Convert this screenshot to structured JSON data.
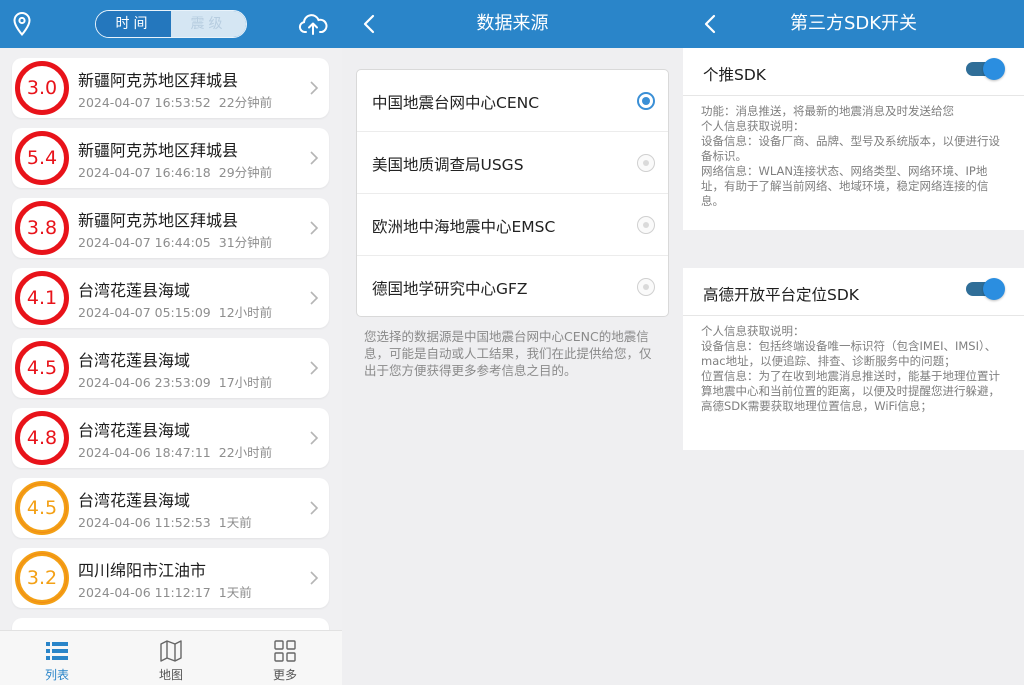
{
  "screen1": {
    "segment": {
      "time": "时间",
      "magnitude": "震级"
    },
    "events": [
      {
        "mag": "3.0",
        "place": "新疆阿克苏地区拜城县",
        "time": "2024-04-07 16:53:52",
        "ago": "22分钟前",
        "level": "red"
      },
      {
        "mag": "5.4",
        "place": "新疆阿克苏地区拜城县",
        "time": "2024-04-07 16:46:18",
        "ago": "29分钟前",
        "level": "red"
      },
      {
        "mag": "3.8",
        "place": "新疆阿克苏地区拜城县",
        "time": "2024-04-07 16:44:05",
        "ago": "31分钟前",
        "level": "red"
      },
      {
        "mag": "4.1",
        "place": "台湾花莲县海域",
        "time": "2024-04-07 05:15:09",
        "ago": "12小时前",
        "level": "red"
      },
      {
        "mag": "4.5",
        "place": "台湾花莲县海域",
        "time": "2024-04-06 23:53:09",
        "ago": "17小时前",
        "level": "red"
      },
      {
        "mag": "4.8",
        "place": "台湾花莲县海域",
        "time": "2024-04-06 18:47:11",
        "ago": "22小时前",
        "level": "red"
      },
      {
        "mag": "4.5",
        "place": "台湾花莲县海域",
        "time": "2024-04-06 11:52:53",
        "ago": "1天前",
        "level": "orange"
      },
      {
        "mag": "3.2",
        "place": "四川绵阳市江油市",
        "time": "2024-04-06 11:12:17",
        "ago": "1天前",
        "level": "orange"
      }
    ],
    "tabs": [
      {
        "label": "列表",
        "icon": "list-icon",
        "active": true
      },
      {
        "label": "地图",
        "icon": "map-icon",
        "active": false
      },
      {
        "label": "更多",
        "icon": "grid-icon",
        "active": false
      }
    ]
  },
  "screen2": {
    "title": "数据来源",
    "sources": [
      {
        "label": "中国地震台网中心CENC",
        "selected": true
      },
      {
        "label": "美国地质调查局USGS",
        "selected": false
      },
      {
        "label": "欧洲地中海地震中心EMSC",
        "selected": false
      },
      {
        "label": "德国地学研究中心GFZ",
        "selected": false
      }
    ],
    "note": "您选择的数据源是中国地震台网中心CENC的地震信息，可能是自动或人工结果，我们在此提供给您，仅出于您方便获得更多参考信息之目的。"
  },
  "screen3": {
    "title": "第三方SDK开关",
    "sdks": [
      {
        "name": "个推SDK",
        "enabled": true,
        "lines": [
          "功能：消息推送，将最新的地震消息及时发送给您",
          "个人信息获取说明：",
          "设备信息：设备厂商、品牌、型号及系统版本，以便进行设备标识。",
          "网络信息：WLAN连接状态、网络类型、网络环境、IP地址，有助于了解当前网络、地域环境，稳定网络连接的信息。"
        ]
      },
      {
        "name": "高德开放平台定位SDK",
        "enabled": true,
        "lines": [
          "个人信息获取说明：",
          "设备信息：包括终端设备唯一标识符（包含IMEI、IMSI）、mac地址，以便追踪、排查、诊断服务中的问题；",
          "位置信息：为了在收到地震消息推送时，能基于地理位置计算地震中心和当前位置的距离，以便及时提醒您进行躲避，高德SDK需要获取地理位置信息，WiFi信息；"
        ]
      }
    ]
  },
  "colors": {
    "primary": "#2a85c9",
    "red": "#e8131a",
    "orange": "#f3a015"
  }
}
